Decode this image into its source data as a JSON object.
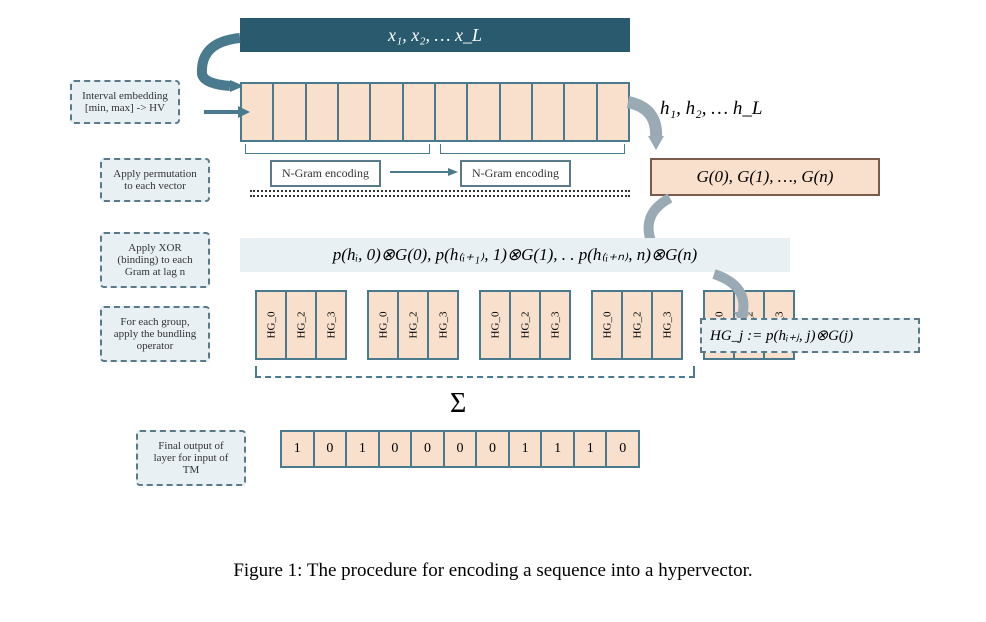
{
  "input_sequence": "x₁, x₂, … x_L",
  "h_sequence": "h₁, h₂, … h_L",
  "g_sequence": "G(0), G(1), …, G(n)",
  "binding_expression": "p(hᵢ, 0)⊗G(0), p(h₍ᵢ₊₁₎, 1)⊗G(1), . . p(h₍ᵢ₊ₙ₎, n)⊗G(n)",
  "hg_definition": "HG_j := p(hᵢ₊ⱼ, j)⊗G(j)",
  "sigma": "Σ",
  "labels": {
    "interval": "Interval embedding [min, max] -> HV",
    "permute": "Apply permutation to each vector",
    "xor": "Apply XOR (binding) to each Gram at lag n",
    "bundle": "For each group, apply the bundling operator",
    "final": "Final output of layer for input of TM"
  },
  "ngram_label": "N-Gram encoding",
  "hg_labels": [
    "HG_0",
    "HG_2",
    "HG_3"
  ],
  "output_bits": [
    "1",
    "0",
    "1",
    "0",
    "0",
    "0",
    "0",
    "1",
    "1",
    "1",
    "0"
  ],
  "caption": "Figure 1: The procedure for encoding a sequence into a hypervector."
}
